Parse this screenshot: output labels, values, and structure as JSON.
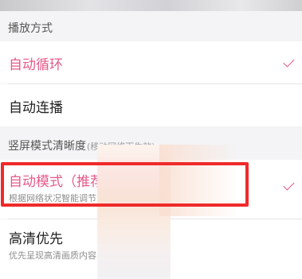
{
  "sections": {
    "playback": {
      "title": "播放方式",
      "options": [
        {
          "label": "自动循环",
          "selected": true
        },
        {
          "label": "自动连播",
          "selected": false
        }
      ]
    },
    "portrait_quality": {
      "title": "竖屏模式清晰度",
      "note": "(移动网络下生效)",
      "options": [
        {
          "label": "自动模式（推荐",
          "desc": "根据网络状况智能调节",
          "selected": true
        },
        {
          "label": "高清优先",
          "desc": "优先呈现高清画质内容",
          "selected": false
        }
      ]
    }
  },
  "colors": {
    "accent": "#e55a8a",
    "highlight": "#ef2a2a",
    "background": "#f4f4f6"
  }
}
